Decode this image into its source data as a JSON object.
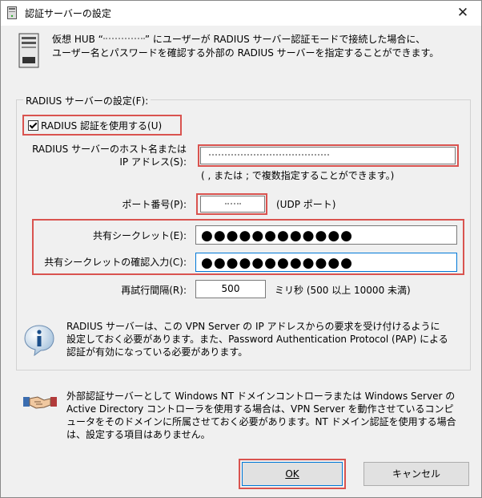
{
  "window": {
    "title": "認証サーバーの設定",
    "close_glyph": "✕"
  },
  "intro": {
    "line1_prefix": "仮想 HUB “",
    "line1_suffix": "” にユーザーが RADIUS サーバー認証モードで接続した場合に、",
    "line2": "ユーザー名とパスワードを確認する外部の RADIUS サーバーを指定することができます。"
  },
  "group": {
    "label": "RADIUS サーバーの設定(F):"
  },
  "checkbox": {
    "label": "RADIUS 認証を使用する(U)",
    "checked": true
  },
  "host": {
    "label_line1": "RADIUS サーバーのホスト名または",
    "label_line2": "IP アドレス(S):",
    "hint": "( , または ; で複数指定することができます。)"
  },
  "port": {
    "label": "ポート番号(P):",
    "note": "(UDP ポート)"
  },
  "secret": {
    "label": "共有シークレット(E):",
    "value": "●●●●●●●●●●●●",
    "confirm_label": "共有シークレットの確認入力(C):",
    "confirm_value": "●●●●●●●●●●●●"
  },
  "retry": {
    "label": "再試行間隔(R):",
    "value": "500",
    "unit": "ミリ秒 (500 以上 10000 未満)"
  },
  "info": {
    "line1": "RADIUS サーバーは、この VPN Server の IP アドレスからの要求を受け付けるように",
    "line2": "設定しておく必要があります。また、Password Authentication Protocol (PAP) による",
    "line3": "認証が有効になっている必要があります。"
  },
  "external": {
    "line1": "外部認証サーバーとして Windows NT ドメインコントローラまたは Windows Server の",
    "line2": "Active Directory コントローラを使用する場合は、VPN Server を動作させているコンピ",
    "line3": "ュータをそのドメインに所属させておく必要があります。NT ドメイン認証を使用する場合",
    "line4": "は、設定する項目はありません。"
  },
  "buttons": {
    "ok": "OK",
    "cancel": "キャンセル"
  },
  "colors": {
    "highlight": "#d9534f",
    "focus": "#0078d7"
  }
}
